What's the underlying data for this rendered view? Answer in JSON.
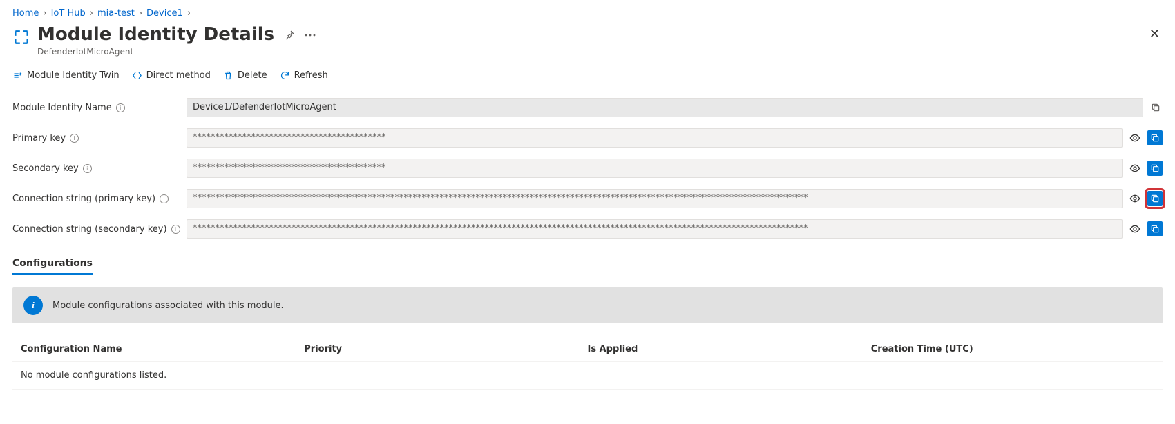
{
  "breadcrumbs": {
    "home": "Home",
    "iothub": "IoT Hub",
    "resource": "mia-test",
    "device": "Device1"
  },
  "header": {
    "title": "Module Identity Details",
    "subtitle": "DefenderIotMicroAgent"
  },
  "toolbar": {
    "twin": "Module Identity Twin",
    "direct": "Direct method",
    "delete": "Delete",
    "refresh": "Refresh"
  },
  "fields": {
    "name_label": "Module Identity Name",
    "name_value": "Device1/DefenderIotMicroAgent",
    "primary_label": "Primary key",
    "primary_value": "*******************************************",
    "secondary_label": "Secondary key",
    "secondary_value": "*******************************************",
    "conn_primary_label": "Connection string (primary key)",
    "conn_primary_value": "*****************************************************************************************************************************************",
    "conn_secondary_label": "Connection string (secondary key)",
    "conn_secondary_value": "*****************************************************************************************************************************************"
  },
  "tabs": {
    "configurations": "Configurations"
  },
  "banner": {
    "text": "Module configurations associated with this module."
  },
  "table": {
    "col_name": "Configuration Name",
    "col_priority": "Priority",
    "col_applied": "Is Applied",
    "col_creation": "Creation Time (UTC)",
    "empty": "No module configurations listed."
  }
}
